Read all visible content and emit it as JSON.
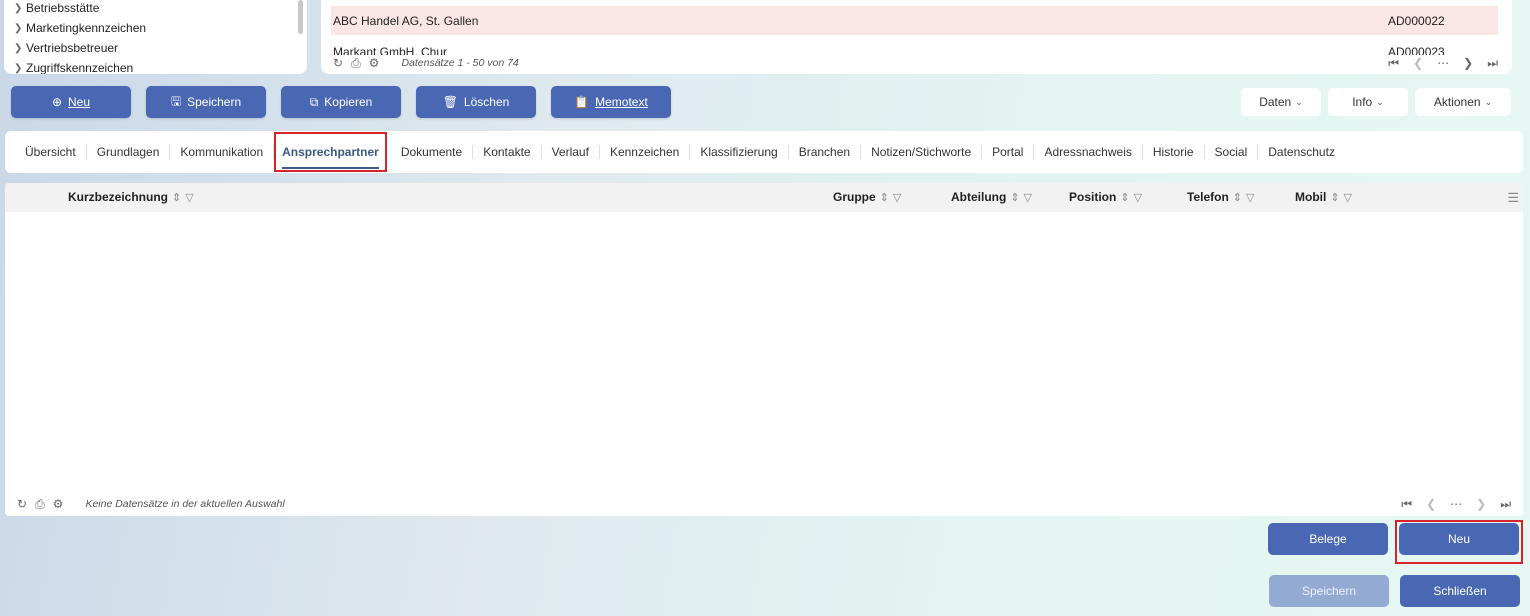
{
  "tree": {
    "items": [
      {
        "label": "Betriebsstätte"
      },
      {
        "label": "Marketingkennzeichen"
      },
      {
        "label": "Vertriebsbetreuer"
      },
      {
        "label": "Zugriffskennzeichen"
      }
    ]
  },
  "top_list": {
    "rows": [
      {
        "name": "ABC Handel AG, St. Gallen",
        "code": "AD000022"
      },
      {
        "name": "Markant GmbH, Chur",
        "code": "AD000023"
      }
    ],
    "footer_text": "Datensätze 1 - 50 von 74"
  },
  "toolbar": {
    "new_label": "Neu",
    "save_label": "Speichern",
    "copy_label": "Kopieren",
    "delete_label": "Löschen",
    "memo_label": "Memotext",
    "data_label": "Daten",
    "info_label": "Info",
    "actions_label": "Aktionen"
  },
  "tabs": [
    {
      "label": "Übersicht"
    },
    {
      "label": "Grundlagen"
    },
    {
      "label": "Kommunikation"
    },
    {
      "label": "Ansprechpartner",
      "active": true
    },
    {
      "label": "Dokumente"
    },
    {
      "label": "Kontakte"
    },
    {
      "label": "Verlauf"
    },
    {
      "label": "Kennzeichen"
    },
    {
      "label": "Klassifizierung"
    },
    {
      "label": "Branchen"
    },
    {
      "label": "Notizen/Stichworte"
    },
    {
      "label": "Portal"
    },
    {
      "label": "Adressnachweis"
    },
    {
      "label": "Historie"
    },
    {
      "label": "Social"
    },
    {
      "label": "Datenschutz"
    }
  ],
  "grid": {
    "columns": [
      {
        "label": "Kurzbezeichnung"
      },
      {
        "label": "Gruppe"
      },
      {
        "label": "Abteilung"
      },
      {
        "label": "Position"
      },
      {
        "label": "Telefon"
      },
      {
        "label": "Mobil"
      }
    ],
    "footer_text": "Keine Datensätze in der aktuellen Auswahl"
  },
  "bottom": {
    "belege_label": "Belege",
    "new_label": "Neu",
    "save_label": "Speichern",
    "close_label": "Schließen"
  },
  "colors": {
    "primary": "#4a67b4",
    "highlight": "#d9232a",
    "selected_row": "#fbe6e6"
  }
}
